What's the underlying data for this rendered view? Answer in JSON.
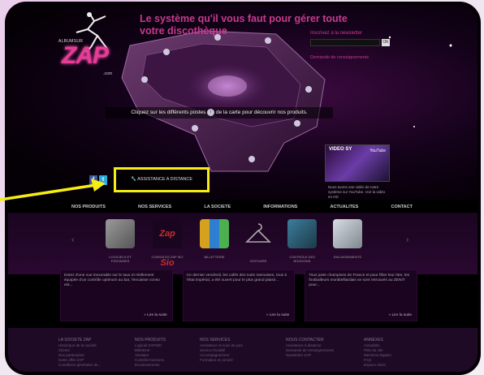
{
  "header": {
    "logo_small": "ALBUMSUR",
    "logo_text": "ZAP",
    "logo_suffix": ".com",
    "tagline": "Le système qu'il vous faut pour gérer toute votre discothèque",
    "newsletter_label": "Inscrivez à la newsletter",
    "newsletter_button": "OK",
    "newsletter_link": "Demande de renseignements"
  },
  "map": {
    "instruction_before": "Cliquez sur les différents postes",
    "instruction_marker": "i",
    "instruction_after": "de la carte pour découvrir nos produits."
  },
  "video": {
    "title": "VIDEO SY",
    "badge": "YouTube",
    "caption": "Nous avons une vidéo de notre système sur YouTube. Voir la vidéo en HD"
  },
  "social": {
    "facebook": "f",
    "twitter": "t"
  },
  "assistance_button": "ASSISTANCE A DISTANCE",
  "nav": [
    "NOS PRODUITS",
    "NOS SERVICES",
    "LA SOCIETE",
    "INFORMATIONS",
    "ACTUALITES",
    "CONTACT"
  ],
  "carousel": {
    "prev": "‹",
    "next": "›",
    "products": [
      {
        "label": "LOGICIELS ET FONTAINES",
        "color": "#7a7a7a"
      },
      {
        "label": "CONSOLES ZAP SIO",
        "color": "#c43030"
      },
      {
        "label": "BILLETTERIE",
        "color": "#d6a21e"
      },
      {
        "label": "VESTIAIRE",
        "color": "#8b8b8b"
      },
      {
        "label": "CONTRÔLE DES BOISSONS",
        "color": "#3d7d9c"
      },
      {
        "label": "ENCAISSEMENTS",
        "color": "#a0a8b0"
      }
    ]
  },
  "columns": [
    {
      "text": "Dotez d'une vue inexorable sur le taux et réellement équipée d'un contrôle optimum au bar, l'encaisse conso est...",
      "link": "» Lire la suite"
    },
    {
      "text": "Ce dernier vendredi, les cafés des nuits Vannaises, tous à l'état impérial, a été ouvert pour le plus grand plaisir...",
      "link": "» Lire la suite"
    },
    {
      "text": "Tous juste champions de France et pour fêter leur titre, les footballeurs montbelliardais se sont retrouvés au ZENIT pour...",
      "link": "» Lire la suite"
    }
  ],
  "footer": [
    {
      "title": "LA SOCIETE ZAP",
      "items": [
        "Historique de la société",
        "Clients",
        "Nos partenaires",
        "Notre offre ZAP",
        "Conditions générales de..."
      ]
    },
    {
      "title": "NOS PRODUITS",
      "items": [
        "Logiciel ZAP500",
        "Billetterie",
        "Vestiaire",
        "Contrôle boissons",
        "Encaissements"
      ]
    },
    {
      "title": "NOS SERVICES",
      "items": [
        "Assistance et suivi de parc",
        "Service fiscalité",
        "Accompagnement",
        "Formation et conseil"
      ]
    },
    {
      "title": "NOUS CONTACTER",
      "items": [
        "Assistance à distance",
        "Demande de renseignements",
        "Newsletter ZAP"
      ]
    },
    {
      "title": "ANNEXES",
      "items": [
        "Actualités",
        "Plan du site",
        "Mentions légales",
        "FAQ",
        "Espace client"
      ]
    }
  ],
  "colors": {
    "accent": "#c63b8f",
    "highlight": "#f6ee13"
  }
}
